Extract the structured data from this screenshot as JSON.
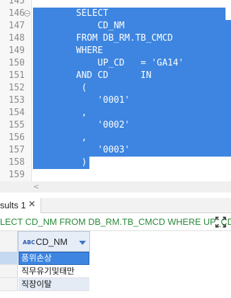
{
  "editor": {
    "lines": [
      {
        "num": "145",
        "code": "",
        "highlighted": false,
        "fold": false
      },
      {
        "num": "146",
        "code": "        SELECT",
        "highlighted": true,
        "fold": true
      },
      {
        "num": "147",
        "code": "            CD_NM",
        "highlighted": true,
        "fold": false
      },
      {
        "num": "148",
        "code": "        FROM DB_RM.TB_CMCD",
        "highlighted": true,
        "fold": false
      },
      {
        "num": "149",
        "code": "        WHERE",
        "highlighted": true,
        "fold": false
      },
      {
        "num": "150",
        "code": "            UP_CD   = 'GA14'",
        "highlighted": true,
        "fold": false
      },
      {
        "num": "151",
        "code": "        AND CD      IN",
        "highlighted": true,
        "fold": false
      },
      {
        "num": "152",
        "code": "         (",
        "highlighted": true,
        "fold": false
      },
      {
        "num": "153",
        "code": "            '0001'",
        "highlighted": true,
        "fold": false
      },
      {
        "num": "154",
        "code": "         ,",
        "highlighted": true,
        "fold": false
      },
      {
        "num": "155",
        "code": "            '0002'",
        "highlighted": true,
        "fold": false
      },
      {
        "num": "156",
        "code": "         ,",
        "highlighted": true,
        "fold": false
      },
      {
        "num": "157",
        "code": "            '0003'",
        "highlighted": true,
        "fold": false
      },
      {
        "num": "158",
        "code": "         )",
        "highlighted": true,
        "fold": false
      },
      {
        "num": "159",
        "code": "",
        "highlighted": false,
        "fold": false
      }
    ]
  },
  "scroll": {
    "left_arrow": "<"
  },
  "results": {
    "tab_label": "sults 1",
    "close_glyph": "✕",
    "query_text": "LECT CD_NM FROM DB_RM.TB_CMCD WHERE UP_CD =",
    "grid": {
      "type_icon": "ABC",
      "column": "CD_NM",
      "rows": [
        "품위손상",
        "직무유기및태만",
        "직장이탈"
      ]
    }
  },
  "colors": {
    "selection": "#3d85e0",
    "query_text": "#2a8a3a"
  }
}
